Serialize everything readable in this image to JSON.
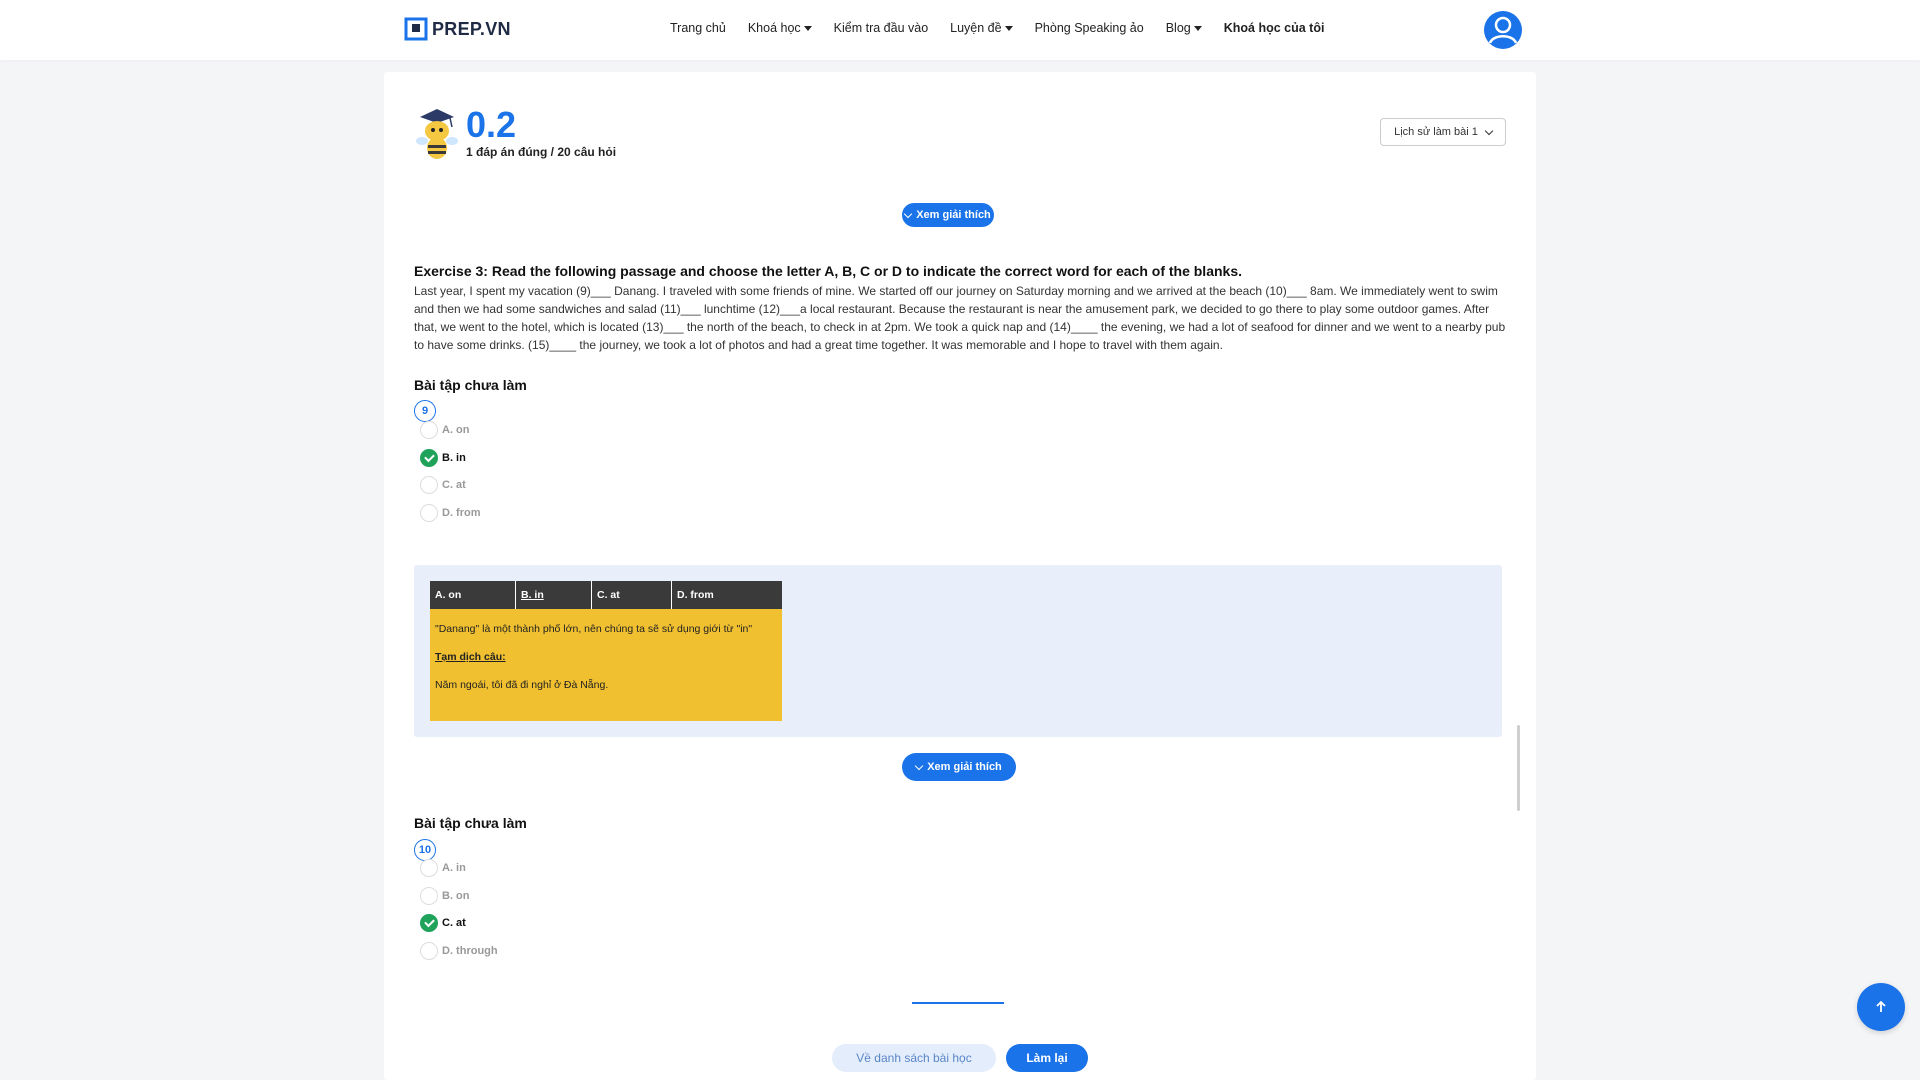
{
  "header": {
    "logo_text": "PREP.VN",
    "nav": [
      {
        "label": "Trang chủ",
        "dropdown": false,
        "bold": false
      },
      {
        "label": "Khoá học",
        "dropdown": true,
        "bold": false
      },
      {
        "label": "Kiểm tra đầu vào",
        "dropdown": false,
        "bold": false
      },
      {
        "label": "Luyện đề",
        "dropdown": true,
        "bold": false
      },
      {
        "label": "Phòng Speaking ảo",
        "dropdown": false,
        "bold": false
      },
      {
        "label": "Blog",
        "dropdown": true,
        "bold": false
      },
      {
        "label": "Khoá học của tôi",
        "dropdown": false,
        "bold": true
      }
    ]
  },
  "result": {
    "score": "0.2",
    "summary": "1 đáp án đúng / 20 câu hỏi",
    "history_label": "Lịch sử làm bài 1"
  },
  "explain_button_label": "Xem giải thích",
  "exercise": {
    "title": "Exercise 3: Read the following passage and choose the letter A, B, C or D to indicate the correct word for each of the blanks.",
    "passage": "Last year, I spent my vacation (9)___ Danang. I traveled with some friends of mine. We started off our journey on Saturday morning and we arrived at the beach (10)___ 8am. We immediately went to swim and then we had some sandwiches and salad (11)___ lunchtime (12)___a local restaurant. Because the restaurant is near the amusement park, we decided to go there to play some outdoor games. After that, we went to the hotel, which is located (13)___ the north of the beach, to check in at 2pm. We took a quick nap and (14)____ the evening, we had a lot of seafood for dinner and we went to a nearby pub to have some drinks. (15)____ the journey, we took a lot of photos and had a great time together. It was memorable and I hope to travel with them again."
  },
  "questions": [
    {
      "status": "Bài tập chưa làm",
      "number": "9",
      "options": [
        "A. on",
        "B. in",
        "C. at",
        "D. from"
      ],
      "selected": 1
    },
    {
      "status": "Bài tập chưa làm",
      "number": "10",
      "options": [
        "A. in",
        "B. on",
        "C. at",
        "D. through"
      ],
      "selected": 2
    }
  ],
  "explanation": {
    "headers": [
      "A. on",
      "B. in",
      "C. at",
      "D. from"
    ],
    "reason": "\"Danang\" là một thành phố lớn, nên chúng ta sẽ sử dụng giới từ \"in\"",
    "translate_label": "Tạm dịch câu:",
    "translation": "Năm ngoái, tôi đã đi nghỉ ở Đà Nẵng."
  },
  "footer": {
    "back_label": "Về danh sách bài học",
    "redo_label": "Làm lại"
  },
  "colors": {
    "primary": "#1a73e8",
    "correct": "#1fa35a",
    "explain_bg": "#e9eefb",
    "note_bg": "#f0c030"
  }
}
